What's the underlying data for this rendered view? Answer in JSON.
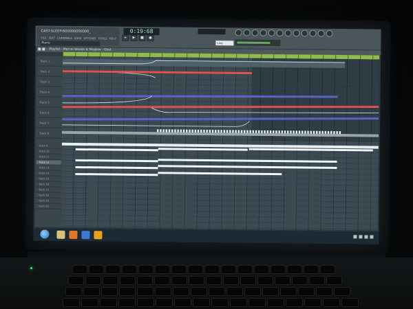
{
  "app": {
    "title": "CAST-SLEEP-B00000000000_",
    "menu": [
      "FILE",
      "EDIT",
      "CHANNELS",
      "VIEW",
      "OPTIONS",
      "TOOLS",
      "HELP"
    ],
    "hint_box": "Piano",
    "time": "0:19:68",
    "snap": "Line"
  },
  "playlist": {
    "title": "Playlist - Marcel Woods & Meglow - Obst",
    "tracks": [
      "Track 1",
      "Track 2",
      "Track 3",
      "Track 4",
      "Track 5",
      "Track 6",
      "Track 7",
      "Track 8"
    ],
    "small_tracks": [
      "Track 9",
      "Track 10",
      "Track 11",
      "Track 12",
      "Track 13",
      "Track 14",
      "Track 15",
      "Track 16",
      "Track 17",
      "Track 18",
      "Track 19",
      "Track 20"
    ]
  },
  "colors": {
    "red_automation": "#e0524a",
    "blue_automation": "#5a64c8",
    "ruler": "#8fbc4a",
    "clip_white": "#f2f5f6"
  },
  "icons": {
    "start": "windows-start-orb",
    "taskbar_apps": [
      "explorer-icon",
      "firefox-icon",
      "media-player-icon",
      "fl-studio-icon"
    ]
  }
}
